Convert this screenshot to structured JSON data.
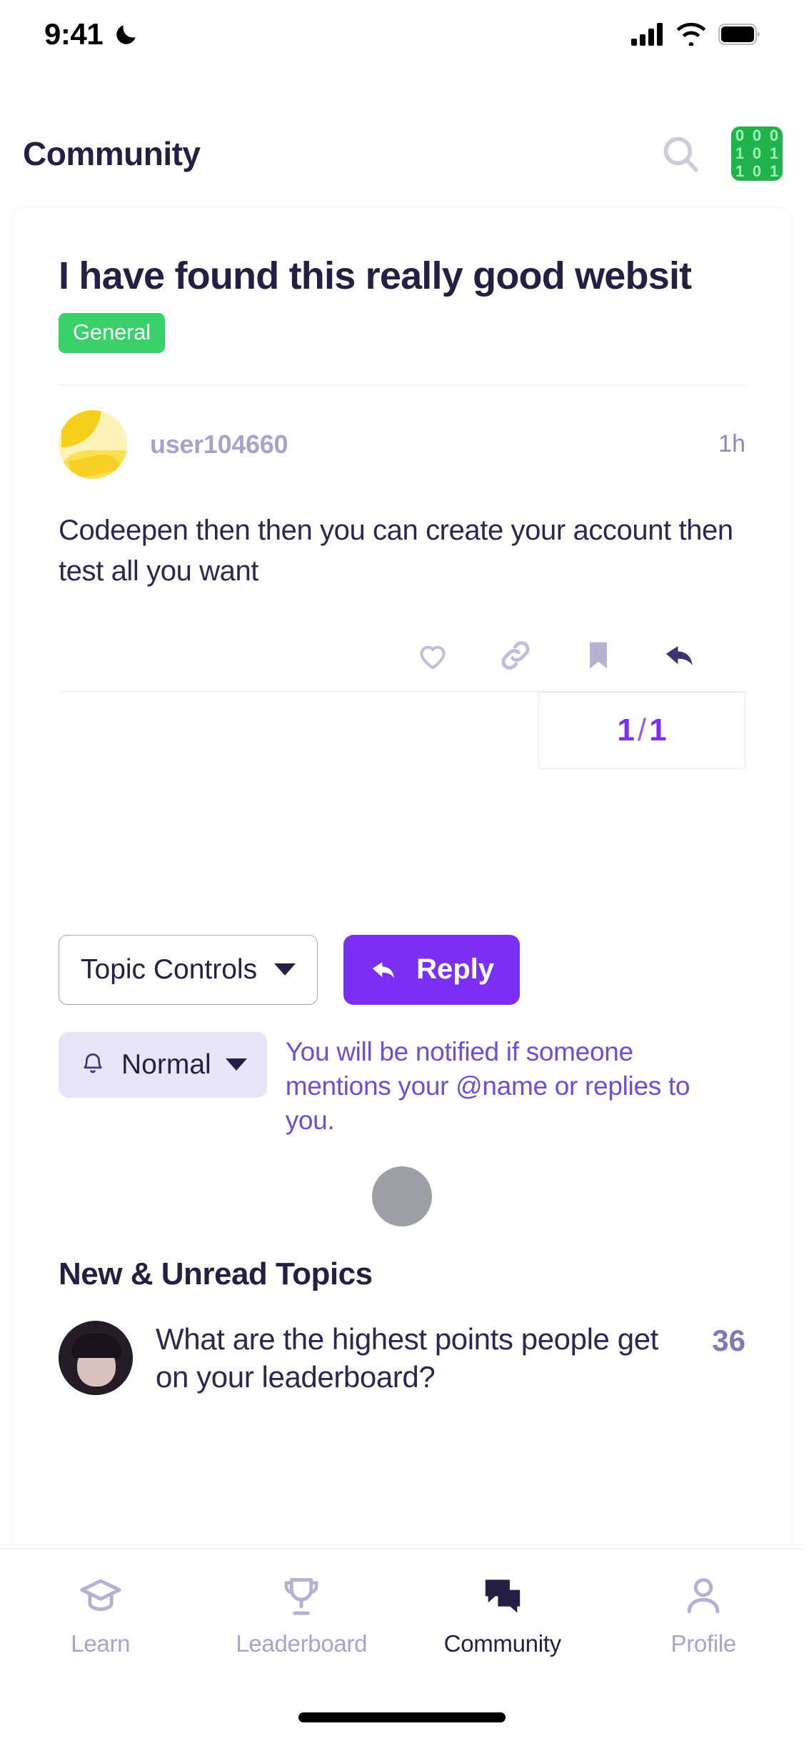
{
  "statusbar": {
    "time": "9:41",
    "dnd_icon": "crescent-moon-icon",
    "signal_icon": "cellular-signal-icon",
    "wifi_icon": "wifi-icon",
    "battery_icon": "battery-full-icon"
  },
  "header": {
    "title": "Community",
    "search_icon": "search-icon",
    "avatar_icon": "binary-avatar-icon",
    "avatar_digits": [
      "0",
      "0",
      "0",
      "1",
      "0",
      "1",
      "1",
      "0",
      "1"
    ],
    "avatar_bg": "#22b24c"
  },
  "post": {
    "title": "I have found this really good websit",
    "category": "General",
    "category_color": "#3ad06a",
    "author": "user104660",
    "timestamp": "1h",
    "body": "Codeepen then then you can create your account then test all you want",
    "actions": [
      {
        "name": "like-icon",
        "label": "Like"
      },
      {
        "name": "link-icon",
        "label": "Copy link"
      },
      {
        "name": "bookmark-icon",
        "label": "Bookmark"
      },
      {
        "name": "reply-arrow-icon",
        "label": "Reply"
      }
    ],
    "pagination": {
      "current": "1",
      "separator": "/",
      "total": "1"
    }
  },
  "controls": {
    "topic_controls_label": "Topic Controls",
    "topic_controls_caret": "chevron-down-icon",
    "reply_label": "Reply",
    "reply_icon": "reply-arrow-icon",
    "reply_color": "#7b2ff2"
  },
  "notification": {
    "bell_icon": "bell-icon",
    "level": "Normal",
    "caret": "chevron-down-icon",
    "description": "You will be notified if someone mentions your @name or replies to you."
  },
  "unread": {
    "section_title": "New & Unread Topics",
    "topics": [
      {
        "avatar": "anime-character-avatar",
        "title": "What are the highest points people get on your leaderboard?",
        "count": "36"
      }
    ]
  },
  "tabbar": {
    "items": [
      {
        "label": "Learn",
        "icon": "graduation-cap-icon",
        "active": false
      },
      {
        "label": "Leaderboard",
        "icon": "trophy-icon",
        "active": false
      },
      {
        "label": "Community",
        "icon": "chat-bubbles-icon",
        "active": true
      },
      {
        "label": "Profile",
        "icon": "person-icon",
        "active": false
      }
    ]
  }
}
